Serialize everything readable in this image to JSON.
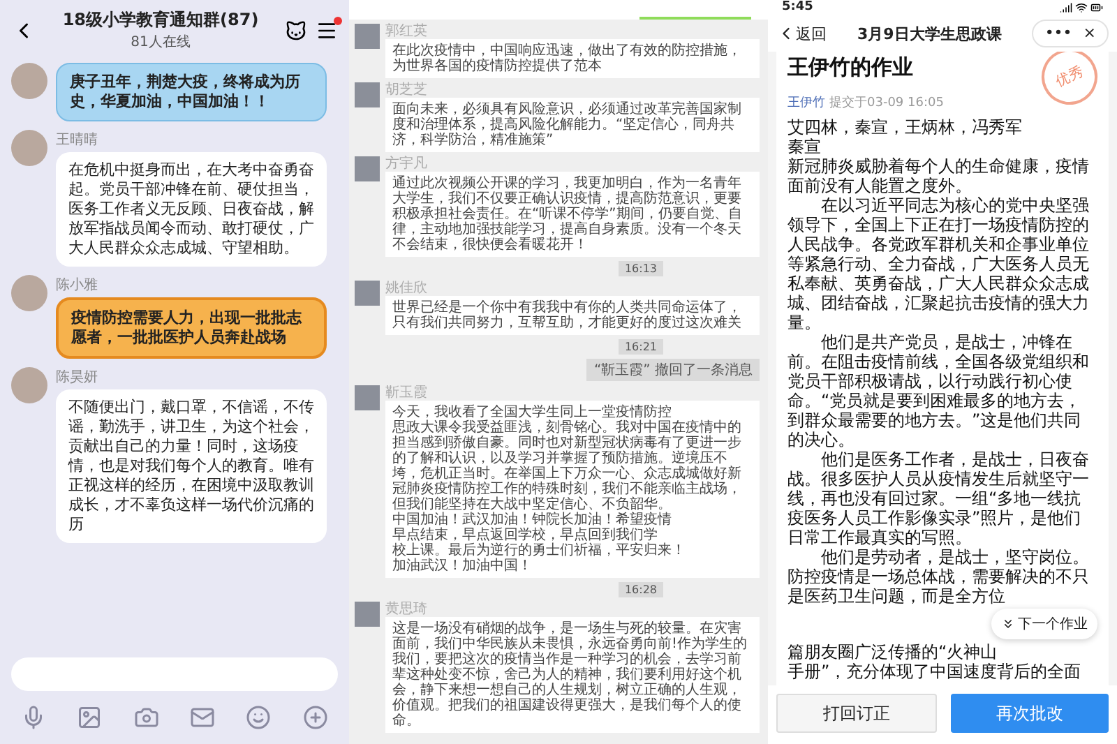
{
  "left_chat": {
    "title": "18级小学教育通知群(87)",
    "online": "81人在线",
    "messages": [
      {
        "kind": "blue",
        "text": "庚子丑年，荆楚大疫，终将成为历史，华夏加油，中国加油！！"
      },
      {
        "kind": "plain",
        "sender": "王晴晴",
        "text": "在危机中挺身而出，在大考中奋勇奋起。党员干部冲锋在前、硬仗担当，医务工作者义无反顾、日夜奋战，解放军指战员闻令而动、敢打硬仗，广大人民群众众志成城、守望相助。"
      },
      {
        "kind": "orange",
        "sender": "陈小雅",
        "text": "疫情防控需要人力，出现一批批志愿者，一批批医护人员奔赴战场"
      },
      {
        "kind": "plain",
        "sender": "陈昊妍",
        "text": "不随便出门，戴口罩，不信谣，不传谣，勤洗手，讲卫生，为这个社会，贡献出自己的力量！同时，这场疫情，也是对我们每个人的教育。唯有正视这样的经历，在困境中汲取教训成长，才不辜负这样一场代价沉痛的历"
      }
    ]
  },
  "middle_chat": {
    "items": [
      {
        "kind": "message",
        "sender": "郭红英",
        "text": "在此次疫情中，中国响应迅速，做出了有效的防控措施，为世界各国的疫情防控提供了范本"
      },
      {
        "kind": "message",
        "sender": "胡芝芝",
        "text": "面向未来，必须具有风险意识，必须通过改革完善国家制度和治理体系，提高风险化解能力。“坚定信心，同舟共济，科学防治，精准施策”"
      },
      {
        "kind": "message",
        "sender": "方宇凡",
        "text": "通过此次视频公开课的学习，我更加明白，作为一名青年大学生，我们不仅要正确认识疫情，提高防范意识，更要积极承担社会责任。在“听课不停学”期间，仍要自觉、自律，主动地加强技能学习，提高自身素质。没有一个冬天不会结束，很快便会看暖花开！"
      },
      {
        "kind": "time",
        "text": "16:13"
      },
      {
        "kind": "message",
        "sender": "姚佳欣",
        "text": "世界已经是一个你中有我我中有你的人类共同命运体了，只有我们共同努力，互帮互助，才能更好的度过这次难关"
      },
      {
        "kind": "time",
        "text": "16:21"
      },
      {
        "kind": "notice",
        "text": "“靳玉霞” 撤回了一条消息"
      },
      {
        "kind": "message",
        "sender": "靳玉霞",
        "lines": [
          "今天，我收看了全国大学生同上一堂疫情防控",
          "思政大课令我受益匪浅，刻骨铭心。我对中国在疫情中的担当感到骄傲自豪。同时也对新型冠状病毒有了更进一步的了解和认识，以及学习并掌握了预防措施。逆境压不垮，危机正当时。在举国上下万众一心、众志成城做好新冠肺炎疫情防控工作的特殊时刻，我们不能亲临主战场，但我们能坚持在大战中坚定信心、不负韶华。",
          "中国加油！武汉加油！钟院长加油！希望疫情",
          "早点结束，早点返回学校，早点回到我们学",
          "校上课。最后为逆行的勇士们祈福，平安归来！",
          "加油武汉！加油中国！"
        ]
      },
      {
        "kind": "time",
        "text": "16:28"
      },
      {
        "kind": "message",
        "sender": "黄思琦",
        "text": "这是一场没有硝烟的战争，是一场生与死的较量。在灾害面前，我们中华民族从未畏惧，永远奋勇向前!作为学生的我们，要把这次的疫情当作是一种学习的机会，去学习前辈这种处变不惊，舍己为人的精神，我们要利用好这个机会，静下来想一想自己的人生规划，树立正确的人生观，价值观。把我们的祖国建设得更强大，是我们每个人的使命。"
      }
    ]
  },
  "homework": {
    "status_time": "5:45",
    "back": "返回",
    "nav_title": "3月9日大学生思政课",
    "more": "•••",
    "close": "×",
    "title": "王伊竹的作业",
    "author": "王伊竹",
    "submitted": "提交于03-09 16:05",
    "stamp": "优秀",
    "paragraphs": [
      {
        "indent": false,
        "text": "艾四林，秦宣，王炳林，冯秀军"
      },
      {
        "indent": false,
        "text": "秦宣"
      },
      {
        "indent": false,
        "text": "新冠肺炎威胁着每个人的生命健康，疫情面前没有人能置之度外。"
      },
      {
        "indent": true,
        "text": "在以习近平同志为核心的党中央坚强领导下，全国上下正在打一场疫情防控的人民战争。各党政军群机关和企事业单位等紧急行动、全力奋战，广大医务人员无私奉献、英勇奋战，广大人民群众众志成城、团结奋战，汇聚起抗击疫情的强大力量。"
      },
      {
        "indent": true,
        "text": "他们是共产党员，是战士，冲锋在前。在阻击疫情前线，全国各级党组织和党员干部积极请战，以行动践行初心使命。“党员就是要到困难最多的地方去，到群众最需要的地方去。”这是他们共同的决心。"
      },
      {
        "indent": true,
        "text": "他们是医务工作者，是战士，日夜奋战。很多医护人员从疫情发生后就坚守一线，再也没有回过家。一组“多地一线抗疫医务人员工作影像实录”照片，是他们日常工作最真实的写照。"
      },
      {
        "indent": true,
        "text": "他们是劳动者，是战士，坚守岗位。防控疫情是一场总体战，需要解决的不只是医药卫生问题，而是全方位"
      }
    ],
    "fragments": [
      "篇朋友圈广泛传播的“火神山",
      "手册”，充分体现了中国速度背后的全面"
    ],
    "next_button": "下一个作业",
    "buttons": [
      {
        "kind": "secondary",
        "label": "打回订正"
      },
      {
        "kind": "primary",
        "label": "再次批改"
      }
    ]
  }
}
